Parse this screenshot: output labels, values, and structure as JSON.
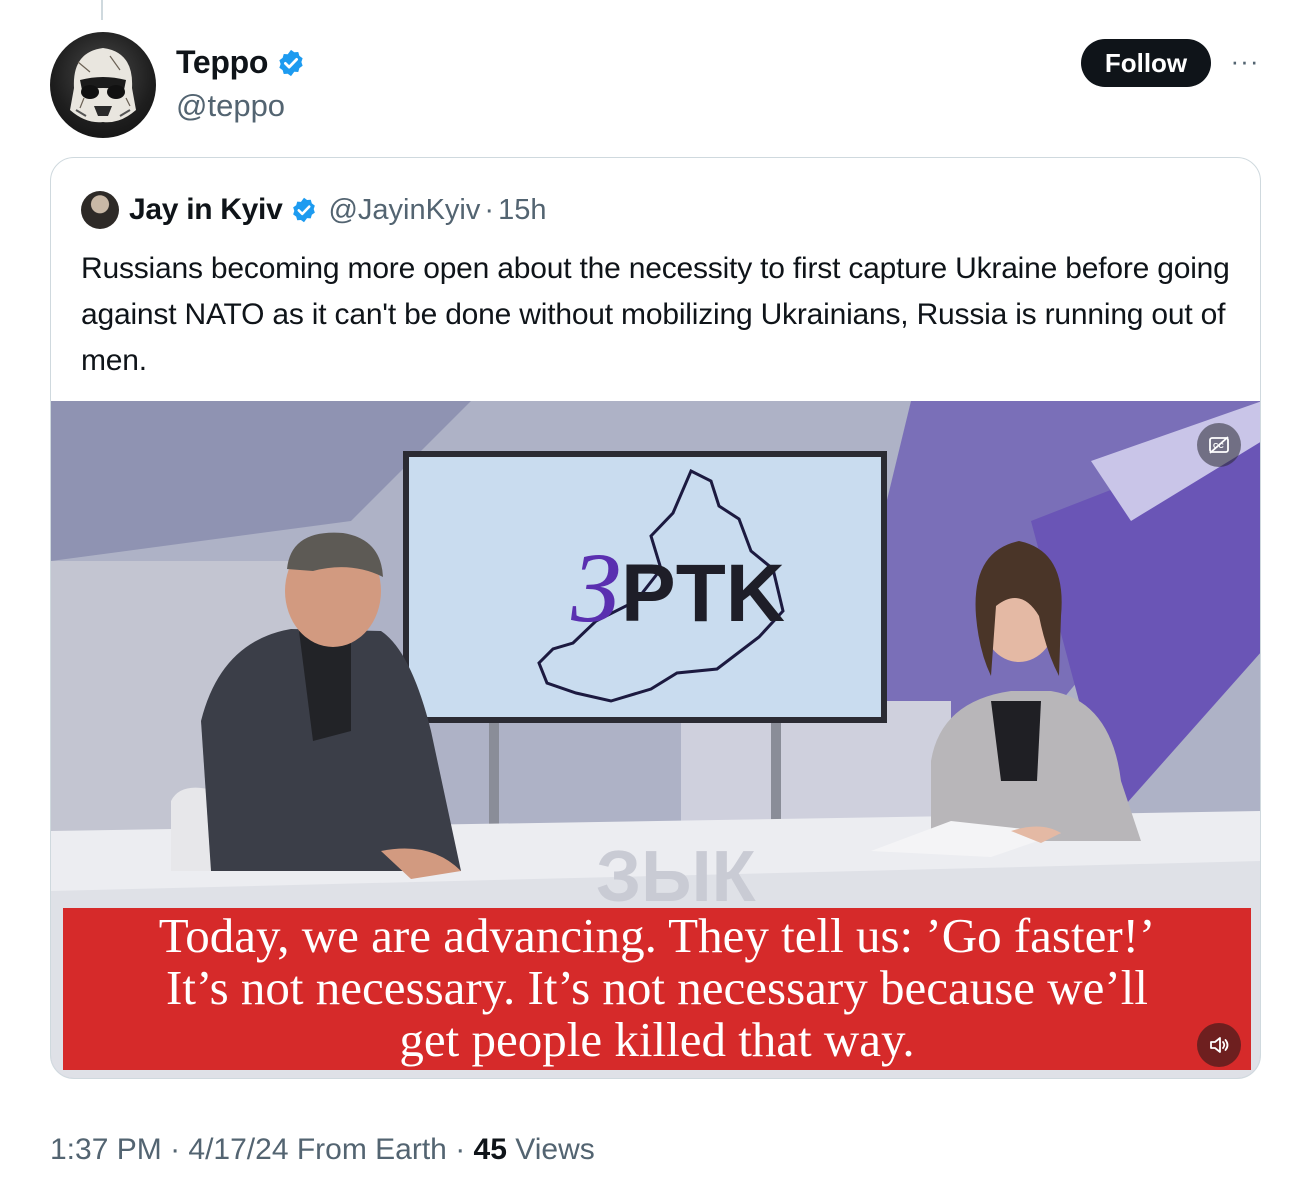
{
  "author": {
    "display_name": "Teppo",
    "handle": "@teppo",
    "verified": true,
    "avatar_icon": "stormtrooper-helmet-avatar"
  },
  "actions": {
    "follow_label": "Follow",
    "more_label": "···"
  },
  "quoted_tweet": {
    "display_name": "Jay in Kyiv",
    "handle": "@JayinKyiv",
    "separator": "·",
    "time": "15h",
    "verified": true,
    "text": "Russians becoming more open about the necessity to first capture Ukraine before going against NATO as it can't be done without mobilizing Ukrainians, Russia is running out of men.",
    "video": {
      "screen_logo": "ЗРТК",
      "desk_text": "ЗЫК",
      "caption_lines": [
        "Today, we are advancing.  They tell us: ’Go faster!’",
        "It’s not necessary. It’s not necessary because we’ll",
        "get people killed that way."
      ],
      "cc_icon": "captions-off-icon",
      "mute_icon": "speaker-muted-icon"
    }
  },
  "meta": {
    "time": "1:37 PM",
    "sep1": " · ",
    "date": "4/17/24",
    "source": " From Earth",
    "sep2": " · ",
    "views_count": "45",
    "views_label": " Views"
  },
  "colors": {
    "verified_blue": "#1d9bf0",
    "follow_bg": "#0f1419",
    "caption_red": "#d62a2a",
    "muted_text": "#536471",
    "border": "#cfd9de"
  }
}
